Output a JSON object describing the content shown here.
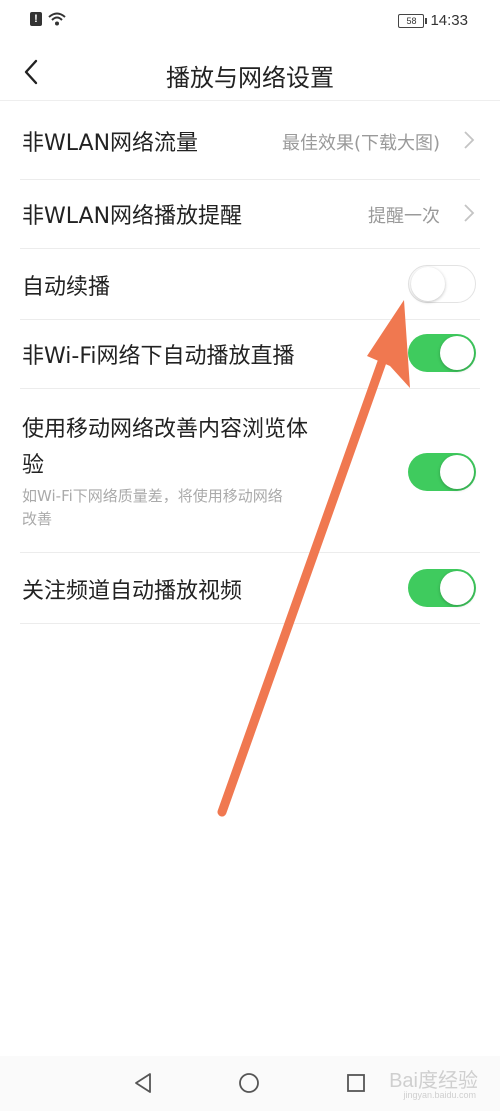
{
  "status_bar": {
    "battery": "58",
    "time": "14:33"
  },
  "header": {
    "title": "播放与网络设置"
  },
  "settings": [
    {
      "label": "非WLAN网络流量",
      "value": "最佳效果(下载大图)"
    },
    {
      "label": "非WLAN网络播放提醒",
      "value": "提醒一次"
    },
    {
      "label": "自动续播",
      "toggle": "off"
    },
    {
      "label": "非Wi-Fi网络下自动播放直播",
      "toggle": "on"
    },
    {
      "label_line1": "使用移动网络改善内容浏览体",
      "label_line2": "验",
      "sub_line1": "如Wi-Fi下网络质量差，将使用移动网络",
      "sub_line2": "改善",
      "toggle": "on"
    },
    {
      "label": "关注频道自动播放视频",
      "toggle": "on"
    }
  ],
  "colors": {
    "toggle_on": "#3fcb5e",
    "annotation_arrow": "#f07850"
  },
  "icons": {
    "back": "chevron-left-icon",
    "nav_back": "triangle-back-icon",
    "nav_home": "circle-home-icon",
    "nav_recent": "square-recent-icon"
  },
  "watermark": {
    "text": "Bai度经验",
    "sub": "jingyan.baidu.com"
  }
}
